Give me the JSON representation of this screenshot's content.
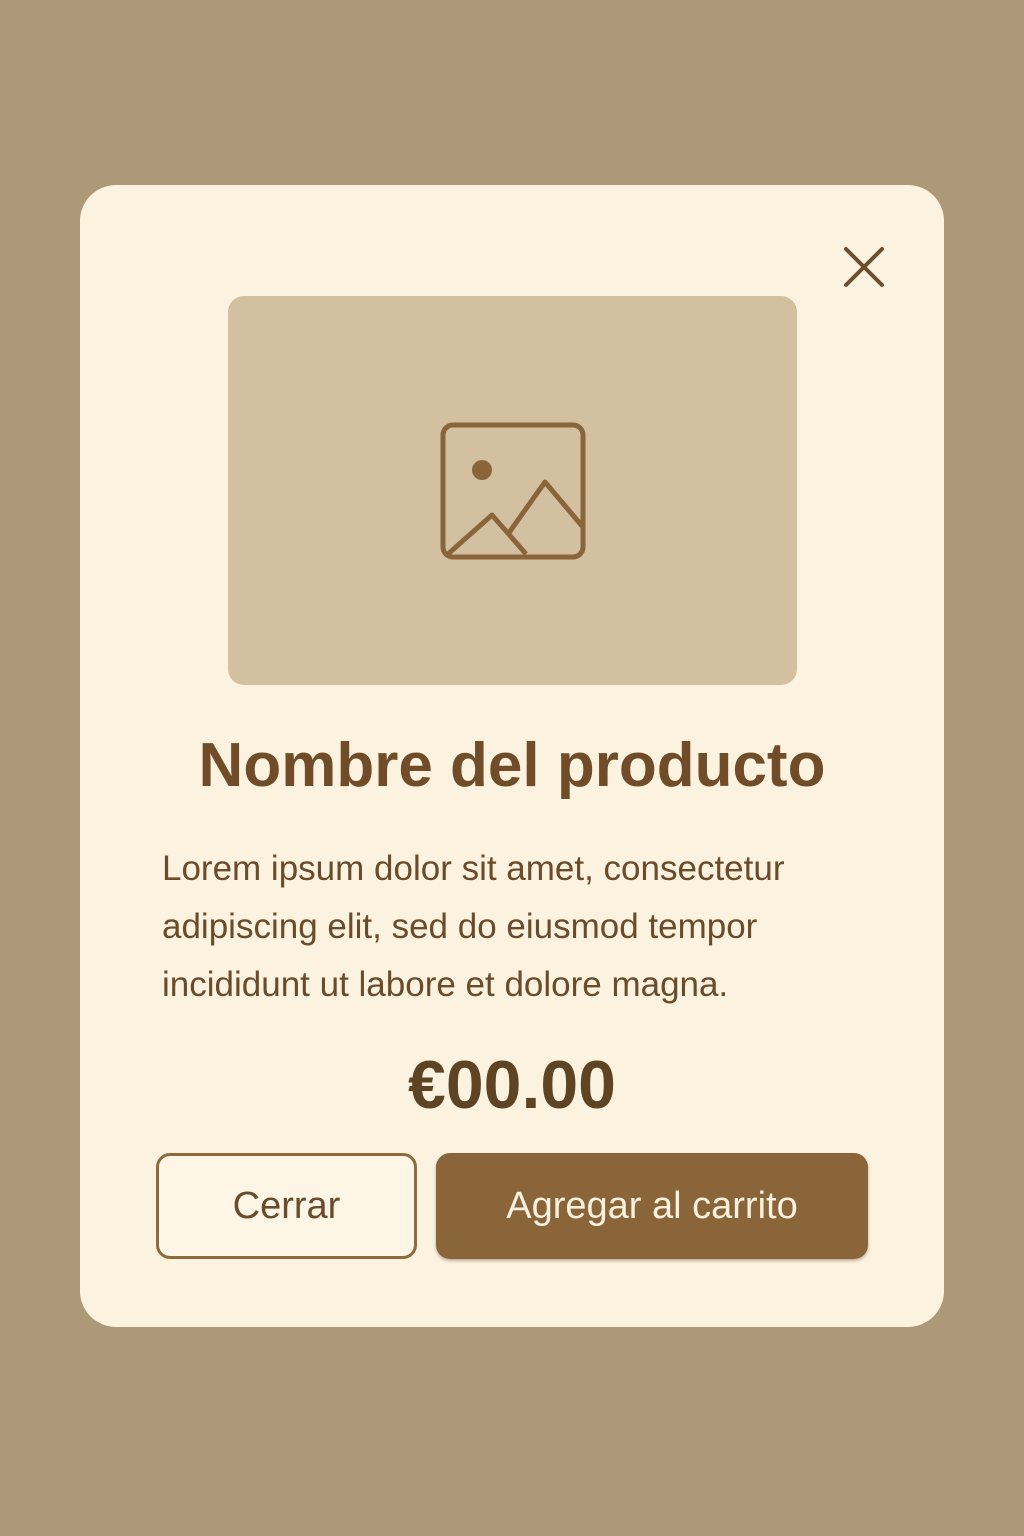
{
  "modal": {
    "close_icon": "close-icon",
    "image_icon": "image-icon",
    "title": "Nombre del producto",
    "description": "Lorem ipsum dolor sit amet, consectetur adipiscing elit, sed do eiusmod tempor incididunt ut labore et dolore magna.",
    "price": "€00.00",
    "buttons": {
      "close_label": "Cerrar",
      "add_to_cart_label": "Agregar al carrito"
    }
  },
  "colors": {
    "backdrop": "#ad9878",
    "modal_background": "#fcf2e0",
    "image_placeholder": "#d2c0a0",
    "accent": "#8a653a",
    "text": "#704d28"
  }
}
